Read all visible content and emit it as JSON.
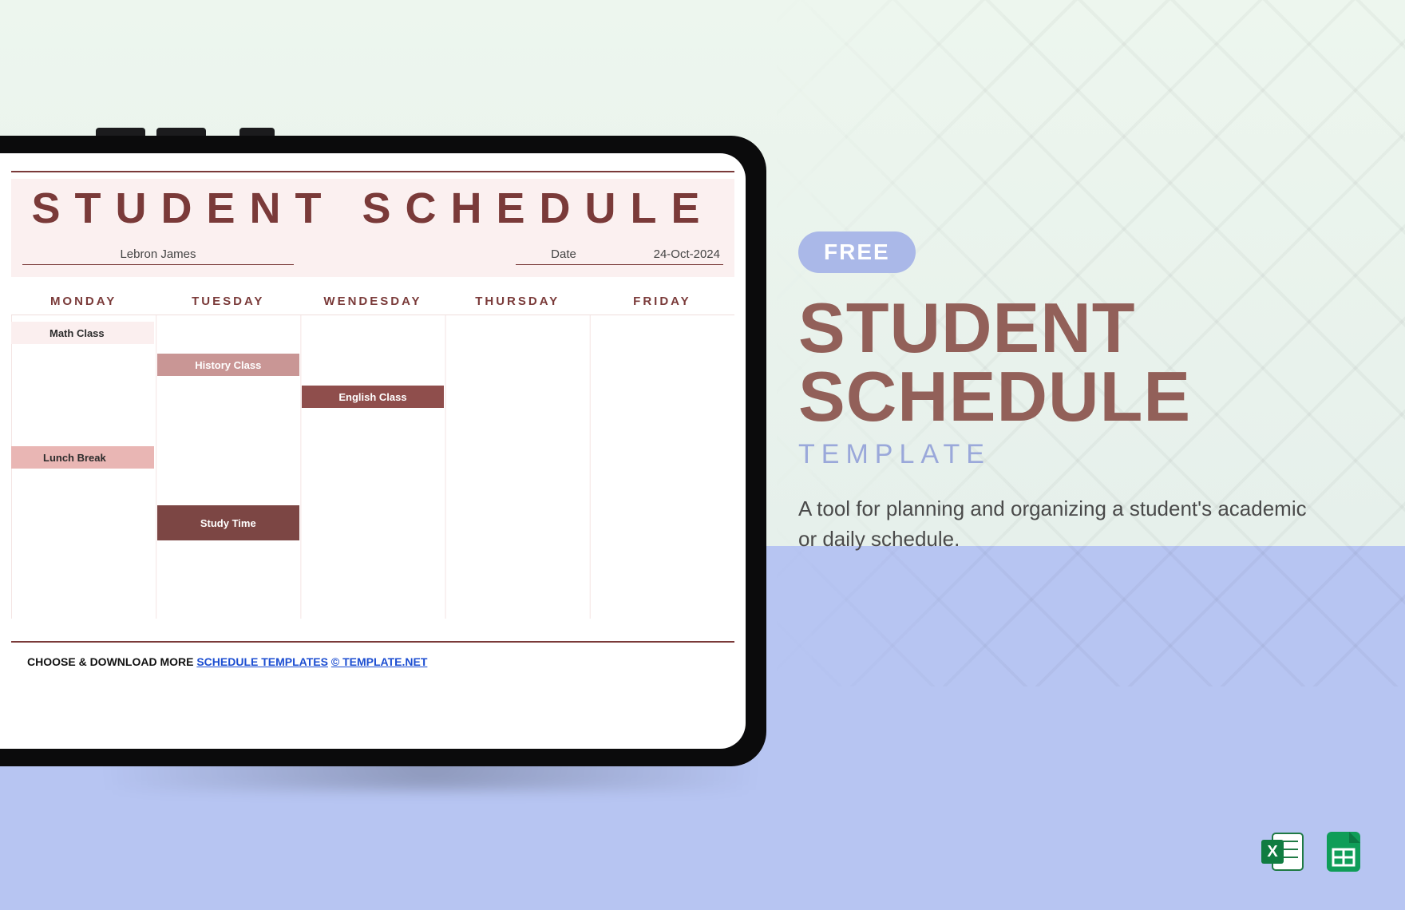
{
  "doc": {
    "title": "STUDENT SCHEDULE",
    "student_name": "Lebron James",
    "date_label": "Date",
    "date_value": "24-Oct-2024",
    "days": [
      "MONDAY",
      "TUESDAY",
      "WENDESDAY",
      "THURSDAY",
      "FRIDAY"
    ],
    "blocks": {
      "math": "Math Class",
      "history": "History Class",
      "english": "English Class",
      "lunch": "Lunch Break",
      "study": "Study Time"
    },
    "footer_prefix": "CHOOSE & DOWNLOAD MORE ",
    "footer_link1": "SCHEDULE TEMPLATES",
    "footer_sep": "  ",
    "footer_link2": "©  TEMPLATE.NET"
  },
  "promo": {
    "badge": "FREE",
    "heading_line1": "STUDENT",
    "heading_line2": "SCHEDULE",
    "subheading": "TEMPLATE",
    "description": "A tool for planning and organizing a student's academic or daily schedule."
  },
  "icons": {
    "excel_label": "X",
    "sheets_label": ""
  }
}
